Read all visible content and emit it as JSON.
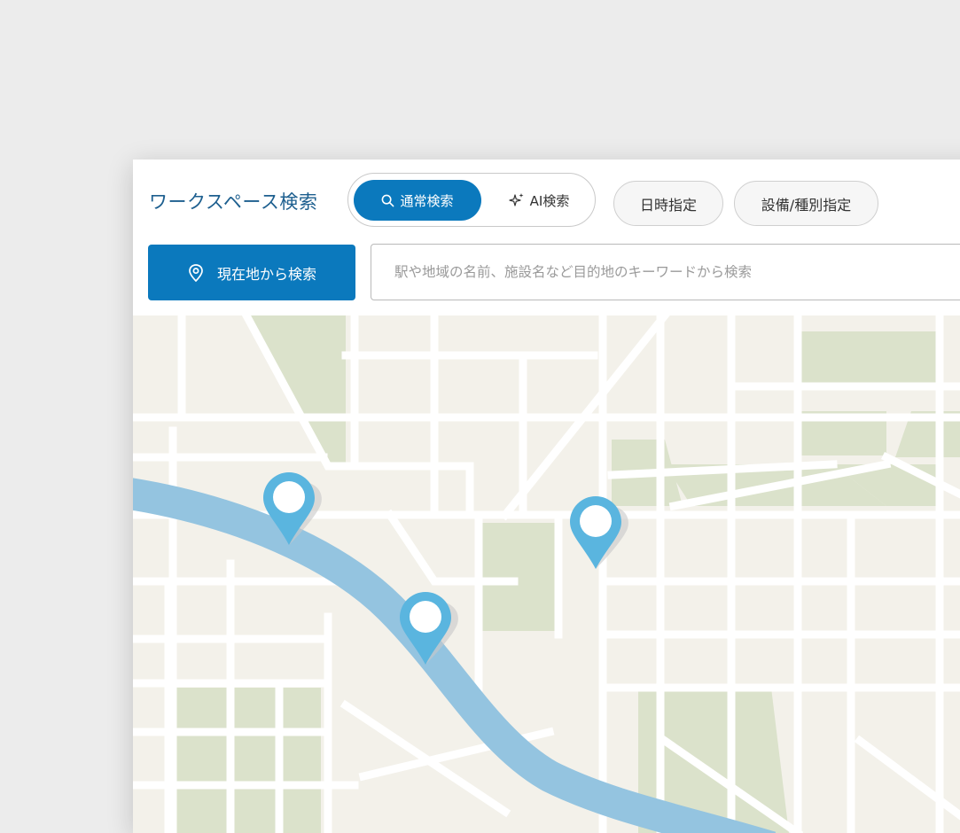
{
  "header": {
    "title": "ワークスペース検索",
    "tabs": [
      {
        "label": "通常検索",
        "icon": "search-icon",
        "active": true
      },
      {
        "label": "AI検索",
        "icon": "sparkle-icon",
        "active": false
      }
    ],
    "filters": {
      "date_label": "日時指定",
      "equipment_label": "設備/種別指定"
    }
  },
  "search": {
    "location_button_label": "現在地から検索",
    "location_icon": "location-target-icon",
    "placeholder": "駅や地域の名前、施設名など目的地のキーワードから検索"
  },
  "map": {
    "pin_count": 3,
    "colors": {
      "background": "#f3f1ea",
      "park": "#dbe2cb",
      "road": "#ffffff",
      "river": "#94c4e0",
      "pin": "#5ab5df",
      "accent": "#0b79bd"
    }
  }
}
